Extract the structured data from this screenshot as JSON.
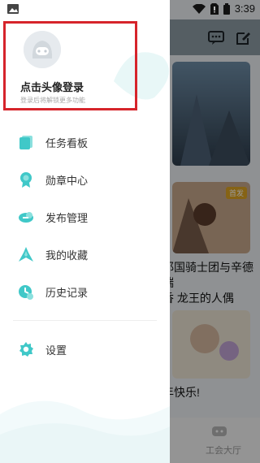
{
  "status_bar": {
    "time": "3:39"
  },
  "drawer": {
    "profile": {
      "login_label": "点击头像登录",
      "login_hint": "登录后将解锁更多功能"
    },
    "menu_items": [
      {
        "label": "任务看板",
        "icon": "task-board-icon"
      },
      {
        "label": "勋章中心",
        "icon": "medal-icon"
      },
      {
        "label": "发布管理",
        "icon": "publish-icon"
      },
      {
        "label": "我的收藏",
        "icon": "star-icon"
      },
      {
        "label": "历史记录",
        "icon": "history-icon"
      }
    ],
    "settings_label": "设置"
  },
  "background": {
    "card2_badge": "首发",
    "card2_title_line1": "耶国骑士团与辛德瑞",
    "card2_title_line2": "香 龙王的人偶",
    "card3_title": "年快乐!",
    "bottom_tab_label": "工会大厅"
  },
  "colors": {
    "accent": "#40c8c8",
    "highlight_border": "#d6242b"
  }
}
